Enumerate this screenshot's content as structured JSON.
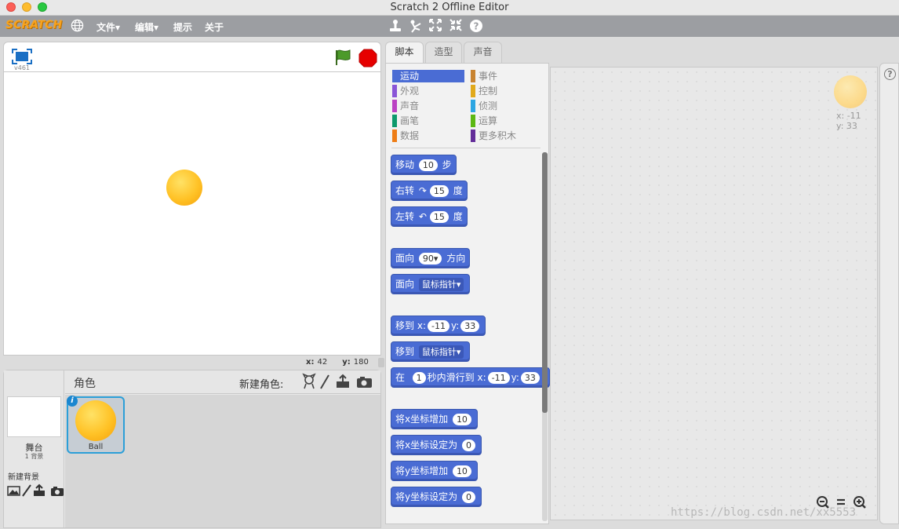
{
  "window": {
    "title": "Scratch 2 Offline Editor"
  },
  "menu": {
    "logo": "SCRATCH",
    "items": [
      "文件▾",
      "编辑▾",
      "提示",
      "关于"
    ],
    "tools": [
      "duplicate-icon",
      "cut-icon",
      "grow-icon",
      "shrink-icon",
      "help-icon"
    ]
  },
  "stage": {
    "version": "v461",
    "coords": {
      "x_label": "x:",
      "x": "42",
      "y_label": "y:",
      "y": "180"
    }
  },
  "sprites": {
    "title": "角色",
    "new_sprite_label": "新建角色:",
    "stage_label": "舞台",
    "stage_sub": "1 背景",
    "new_backdrop_label": "新建背景",
    "list": [
      {
        "name": "Ball"
      }
    ]
  },
  "tabs": [
    "脚本",
    "造型",
    "声音"
  ],
  "categories": [
    {
      "label": "运动",
      "color": "#4a6cd4"
    },
    {
      "label": "事件",
      "color": "#c88330"
    },
    {
      "label": "外观",
      "color": "#8a55d7"
    },
    {
      "label": "控制",
      "color": "#e1a91a"
    },
    {
      "label": "声音",
      "color": "#bb42c3"
    },
    {
      "label": "侦测",
      "color": "#2ca5e2"
    },
    {
      "label": "画笔",
      "color": "#0e9a6c"
    },
    {
      "label": "运算",
      "color": "#5cb712"
    },
    {
      "label": "数据",
      "color": "#ee7d16"
    },
    {
      "label": "更多积木",
      "color": "#632d99"
    }
  ],
  "blocks": {
    "move": {
      "a": "移动",
      "v": "10",
      "b": "步"
    },
    "turn_right": {
      "a": "右转",
      "v": "15",
      "b": "度"
    },
    "turn_left": {
      "a": "左转",
      "v": "15",
      "b": "度"
    },
    "point_dir": {
      "a": "面向",
      "v": "90▾",
      "b": "方向"
    },
    "point_towards": {
      "a": "面向",
      "dd": "鼠标指针▾"
    },
    "goto_xy": {
      "a": "移到",
      "xl": "x:",
      "x": "-11",
      "yl": "y:",
      "y": "33"
    },
    "goto": {
      "a": "移到",
      "dd": "鼠标指针▾"
    },
    "glide": {
      "a": "在",
      "v": "1",
      "b": "秒内滑行到",
      "xl": "x:",
      "x": "-11",
      "yl": "y:",
      "y": "33"
    },
    "change_x": {
      "a": "将x坐标增加",
      "v": "10"
    },
    "set_x": {
      "a": "将x坐标设定为",
      "v": "0"
    },
    "change_y": {
      "a": "将y坐标增加",
      "v": "10"
    },
    "set_y": {
      "a": "将y坐标设定为",
      "v": "0"
    }
  },
  "script_area": {
    "sprite_x": "x: -11",
    "sprite_y": "y: 33"
  },
  "watermark": "https://blog.csdn.net/xx5553"
}
